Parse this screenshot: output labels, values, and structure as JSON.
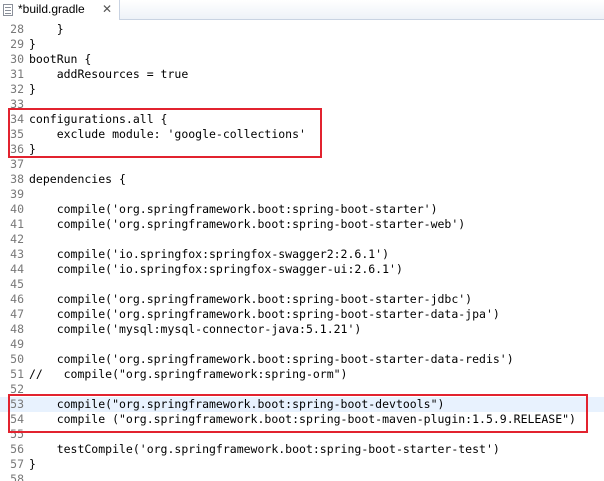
{
  "tab": {
    "title": "*build.gradle",
    "close_glyph": "✕"
  },
  "editor": {
    "current_line": 53,
    "lines": [
      {
        "num": "28",
        "text": "    }"
      },
      {
        "num": "29",
        "text": "}"
      },
      {
        "num": "30",
        "text": "bootRun {"
      },
      {
        "num": "31",
        "text": "    addResources = true"
      },
      {
        "num": "32",
        "text": "}"
      },
      {
        "num": "33",
        "text": ""
      },
      {
        "num": "34",
        "text": "configurations.all {"
      },
      {
        "num": "35",
        "text": "    exclude module: 'google-collections'"
      },
      {
        "num": "36",
        "text": "}"
      },
      {
        "num": "37",
        "text": ""
      },
      {
        "num": "38",
        "text": "dependencies {"
      },
      {
        "num": "39",
        "text": ""
      },
      {
        "num": "40",
        "text": "    compile('org.springframework.boot:spring-boot-starter')"
      },
      {
        "num": "41",
        "text": "    compile('org.springframework.boot:spring-boot-starter-web')"
      },
      {
        "num": "42",
        "text": ""
      },
      {
        "num": "43",
        "text": "    compile('io.springfox:springfox-swagger2:2.6.1')"
      },
      {
        "num": "44",
        "text": "    compile('io.springfox:springfox-swagger-ui:2.6.1')"
      },
      {
        "num": "45",
        "text": ""
      },
      {
        "num": "46",
        "text": "    compile('org.springframework.boot:spring-boot-starter-jdbc')"
      },
      {
        "num": "47",
        "text": "    compile('org.springframework.boot:spring-boot-starter-data-jpa')"
      },
      {
        "num": "48",
        "text": "    compile('mysql:mysql-connector-java:5.1.21')"
      },
      {
        "num": "49",
        "text": ""
      },
      {
        "num": "50",
        "text": "    compile('org.springframework.boot:spring-boot-starter-data-redis')"
      },
      {
        "num": "51",
        "text": "//   compile(\"org.springframework:spring-orm\")"
      },
      {
        "num": "52",
        "text": ""
      },
      {
        "num": "53",
        "text": "    compile(\"org.springframework.boot:spring-boot-devtools\")"
      },
      {
        "num": "54",
        "text": "    compile (\"org.springframework.boot:spring-boot-maven-plugin:1.5.9.RELEASE\")"
      },
      {
        "num": "55",
        "text": ""
      },
      {
        "num": "56",
        "text": "    testCompile('org.springframework.boot:spring-boot-starter-test')"
      },
      {
        "num": "57",
        "text": "}"
      },
      {
        "num": "58",
        "text": ""
      }
    ]
  },
  "colors": {
    "highlight_border": "#e2232f",
    "current_line_bg": "#e8f2fe",
    "line_number": "#787878"
  }
}
